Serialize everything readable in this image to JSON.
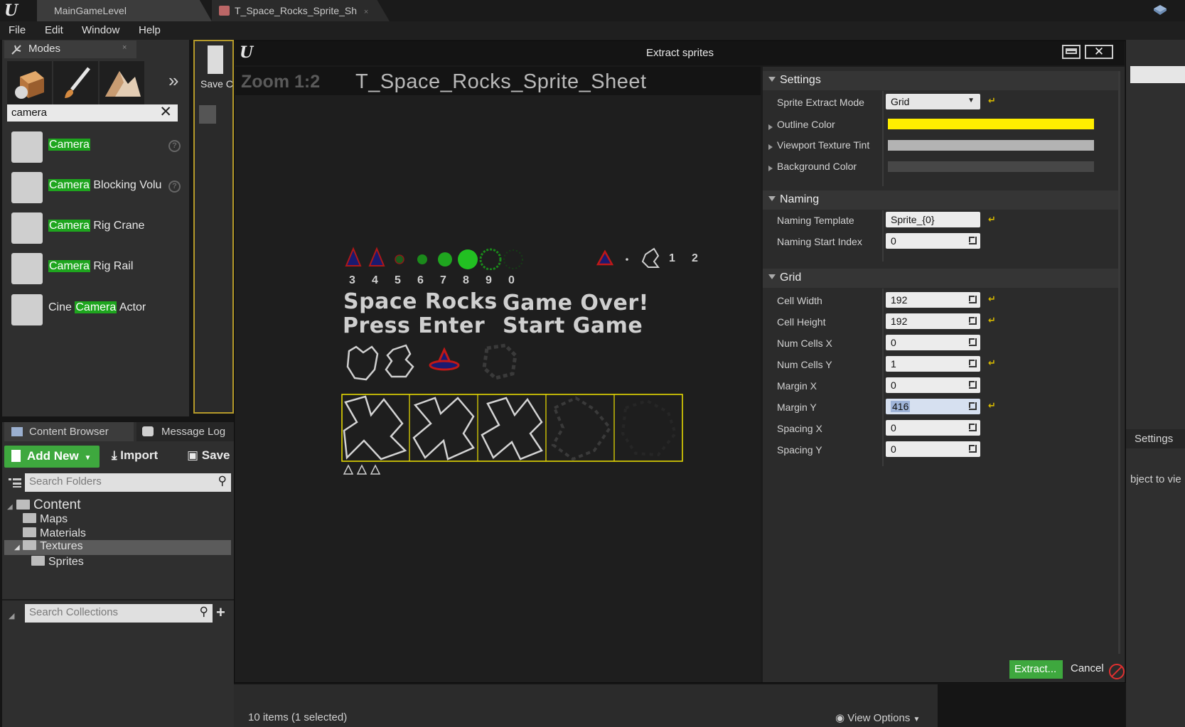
{
  "titlebar": {
    "tabs": [
      {
        "label": "MainGameLevel"
      },
      {
        "label": "T_Space_Rocks_Sprite_Sh"
      }
    ]
  },
  "menubar": {
    "items": [
      "File",
      "Edit",
      "Window",
      "Help"
    ]
  },
  "modes": {
    "tab_label": "Modes",
    "search_value": "camera",
    "items": [
      {
        "highlight": "Camera",
        "rest": "",
        "prefix": ""
      },
      {
        "highlight": "Camera",
        "rest": " Blocking Volu",
        "prefix": ""
      },
      {
        "highlight": "Camera",
        "rest": " Rig Crane",
        "prefix": ""
      },
      {
        "highlight": "Camera",
        "rest": " Rig Rail",
        "prefix": ""
      },
      {
        "highlight": "Camera",
        "rest": " Actor",
        "prefix": "Cine "
      }
    ],
    "viewport_save_label": "Save C"
  },
  "content_browser": {
    "tabs": [
      "Content Browser",
      "Message Log"
    ],
    "add_new": "Add New",
    "import": "Import",
    "save": "Save",
    "search_folders_placeholder": "Search Folders",
    "search_collections_placeholder": "Search Collections",
    "tree": [
      "Content",
      "Maps",
      "Materials",
      "Textures",
      "Sprites"
    ],
    "status": "10 items (1 selected)",
    "view_options": "View Options"
  },
  "dialog": {
    "title": "Extract sprites",
    "zoom": "Zoom 1:2",
    "texture_name": "T_Space_Rocks_Sprite_Sheet",
    "sheet_digits_top": [
      "3",
      "4",
      "5",
      "6",
      "7",
      "8",
      "9",
      "0"
    ],
    "sheet_digits_right": [
      "1",
      "2"
    ],
    "sheet_text": [
      "Space Rocks",
      "Game Over!",
      "Press Enter",
      "Start Game"
    ],
    "sections": {
      "settings": {
        "title": "Settings",
        "sprite_extract_mode_label": "Sprite Extract Mode",
        "sprite_extract_mode_value": "Grid",
        "outline_color_label": "Outline Color",
        "outline_color": "#ffee00",
        "viewport_texture_tint_label": "Viewport Texture Tint",
        "viewport_texture_tint": "#b3b3b3",
        "background_color_label": "Background Color",
        "background_color": "#474747"
      },
      "naming": {
        "title": "Naming",
        "template_label": "Naming Template",
        "template_value": "Sprite_{0}",
        "start_index_label": "Naming Start Index",
        "start_index_value": "0"
      },
      "grid": {
        "title": "Grid",
        "rows": [
          {
            "label": "Cell Width",
            "value": "192",
            "reset": true
          },
          {
            "label": "Cell Height",
            "value": "192",
            "reset": true
          },
          {
            "label": "Num Cells X",
            "value": "0",
            "reset": false
          },
          {
            "label": "Num Cells Y",
            "value": "1",
            "reset": true
          },
          {
            "label": "Margin X",
            "value": "0",
            "reset": false
          },
          {
            "label": "Margin Y",
            "value": "416",
            "reset": true
          },
          {
            "label": "Spacing X",
            "value": "0",
            "reset": false
          },
          {
            "label": "Spacing Y",
            "value": "0",
            "reset": false
          }
        ]
      }
    },
    "extract_button": "Extract...",
    "cancel_button": "Cancel"
  },
  "right_panel": {
    "settings_label": "Settings",
    "hint_text": "bject to vie"
  },
  "colors": {
    "accent_green": "#3ea83e",
    "highlight_green": "#1ea51e",
    "grid_outline": "#ffee00"
  }
}
